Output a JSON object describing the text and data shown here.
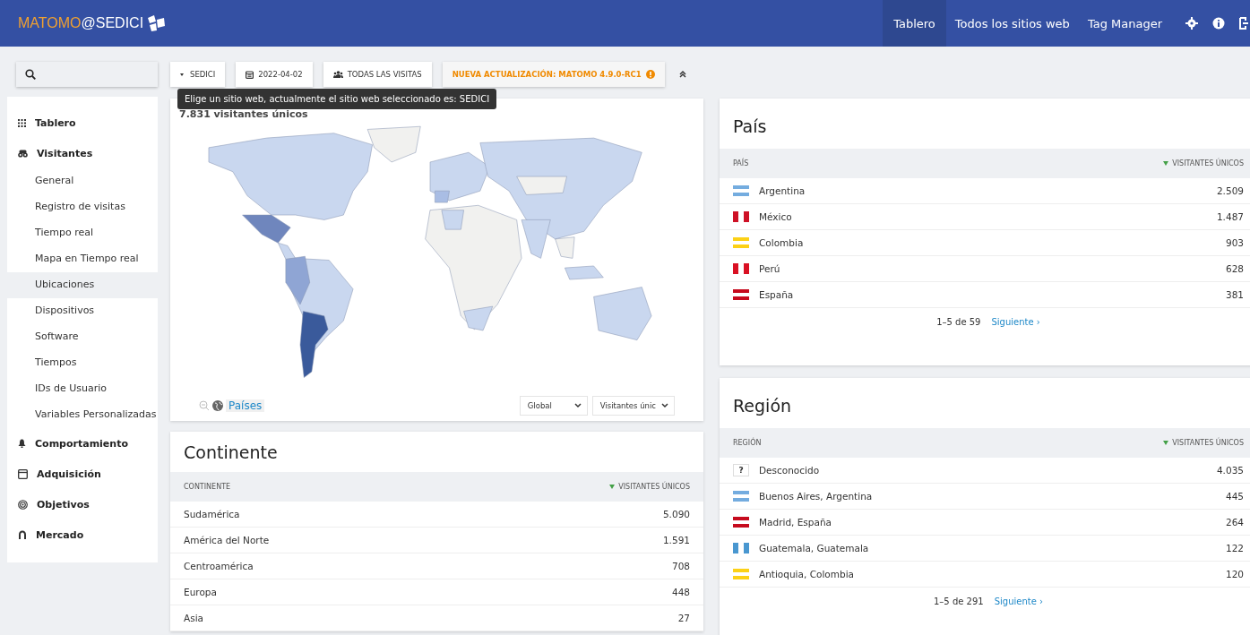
{
  "header": {
    "logo_brand": "MATOMO",
    "logo_site": "@SEDICI",
    "nav": [
      {
        "label": "Tablero",
        "selected": true
      },
      {
        "label": "Todos los sitios web",
        "selected": false
      },
      {
        "label": "Tag Manager",
        "selected": false
      }
    ]
  },
  "toolbar": {
    "site": "SEDICI",
    "date": "2022-04-02",
    "segment": "TODAS LAS VISITAS",
    "update_notice": "NUEVA ACTUALIZACIÓN: MATOMO 4.9.0-RC1",
    "tooltip": "Elige un sitio web, actualmente el sitio web seleccionado es: SEDICI"
  },
  "sidebar": {
    "items": [
      {
        "label": "Tablero"
      },
      {
        "label": "Visitantes",
        "children": [
          {
            "label": "General",
            "selected": false
          },
          {
            "label": "Registro de visitas",
            "selected": false
          },
          {
            "label": "Tiempo real",
            "selected": false
          },
          {
            "label": "Mapa en Tiempo real",
            "selected": false
          },
          {
            "label": "Ubicaciones",
            "selected": true
          },
          {
            "label": "Dispositivos",
            "selected": false
          },
          {
            "label": "Software",
            "selected": false
          },
          {
            "label": "Tiempos",
            "selected": false
          },
          {
            "label": "IDs de Usuario",
            "selected": false
          },
          {
            "label": "Variables Personalizadas",
            "selected": false
          }
        ]
      },
      {
        "label": "Comportamiento"
      },
      {
        "label": "Adquisición"
      },
      {
        "label": "Objetivos"
      },
      {
        "label": "Mercado"
      }
    ]
  },
  "map_widget": {
    "title": "7.831 visitantes únicos",
    "link": "Países",
    "region_select": "Global",
    "metric_select": "Visitantes únic"
  },
  "continent": {
    "title": "Continente",
    "columns": [
      "CONTINENTE",
      "VISITANTES ÚNICOS"
    ],
    "rows": [
      {
        "label": "Sudamérica",
        "value": "5.090"
      },
      {
        "label": "América del Norte",
        "value": "1.591"
      },
      {
        "label": "Centroamérica",
        "value": "708"
      },
      {
        "label": "Europa",
        "value": "448"
      },
      {
        "label": "Asia",
        "value": "27"
      }
    ]
  },
  "country": {
    "title": "País",
    "columns": [
      "PAÍS",
      "VISITANTES ÚNICOS"
    ],
    "rows": [
      {
        "label": "Argentina",
        "value": "2.509",
        "kind": "h-stripes",
        "color": "#74acdf"
      },
      {
        "label": "México",
        "value": "1.487",
        "kind": "v-stripes",
        "color": "#ce1126"
      },
      {
        "label": "Colombia",
        "value": "903",
        "kind": "h-stripes",
        "color": "#fcd116"
      },
      {
        "label": "Perú",
        "value": "628",
        "kind": "v-stripes",
        "color": "#d91023"
      },
      {
        "label": "España",
        "value": "381",
        "kind": "h-stripes",
        "color": "#c60b1e"
      }
    ],
    "pagination": "1–5 de 59",
    "next": "Siguiente ›"
  },
  "region": {
    "title": "Región",
    "columns": [
      "REGIÓN",
      "VISITANTES ÚNICOS"
    ],
    "rows": [
      {
        "label": "Desconocido",
        "value": "4.035",
        "kind": "unknown",
        "mark": "?"
      },
      {
        "label": "Buenos Aires, Argentina",
        "value": "445",
        "kind": "h-stripes",
        "color": "#74acdf"
      },
      {
        "label": "Madrid, España",
        "value": "264",
        "kind": "h-stripes",
        "color": "#c60b1e"
      },
      {
        "label": "Guatemala, Guatemala",
        "value": "122",
        "kind": "v-stripes",
        "color": "#4997d0"
      },
      {
        "label": "Antioquia, Colombia",
        "value": "120",
        "kind": "h-stripes",
        "color": "#fcd116"
      }
    ],
    "pagination": "1–5 de 291",
    "next": "Siguiente ›"
  }
}
